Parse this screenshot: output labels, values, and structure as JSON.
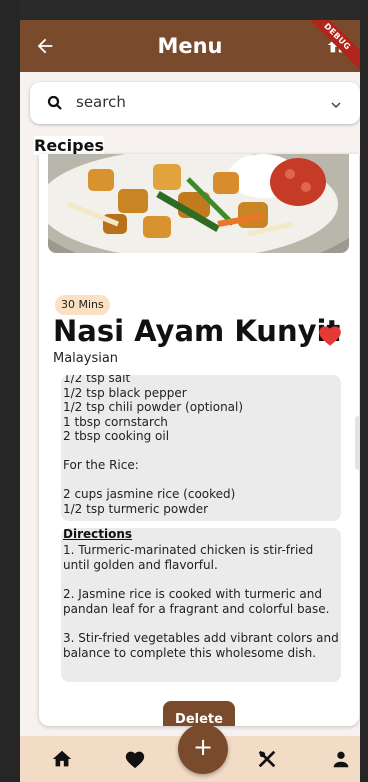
{
  "appbar": {
    "title": "Menu",
    "back_icon": "back-arrow-icon",
    "home_icon": "home-icon",
    "debug_banner": "DEBUG"
  },
  "search": {
    "placeholder": "search",
    "search_icon": "search-icon",
    "dropdown_icon": "chevron-down-icon"
  },
  "section_label": "Recipes",
  "recipe": {
    "time_badge": "30 Mins",
    "name": "Nasi Ayam Kunyit",
    "cuisine": "Malaysian",
    "favorite": true,
    "ingredients": [
      "1/2 tsp salt",
      "1/2 tsp black pepper",
      "1/2 tsp chili powder (optional)",
      "1 tbsp cornstarch",
      "2 tbsp cooking oil",
      "",
      "For the Rice:",
      "",
      "2 cups jasmine rice (cooked)",
      "1/2 tsp turmeric powder"
    ],
    "directions_heading": "Directions",
    "directions": [
      "1. Turmeric-marinated chicken is stir-fried until golden and flavorful.",
      "2. Jasmine rice is cooked with turmeric and pandan leaf for a fragrant and colorful base.",
      "3. Stir-fried vegetables add vibrant colors and balance to complete this wholesome dish."
    ],
    "delete_label": "Delete"
  },
  "bottom_nav": {
    "items": [
      "home-icon",
      "heart-icon",
      "add-icon",
      "utensils-icon",
      "person-icon"
    ],
    "fab_label": "+"
  },
  "colors": {
    "primary": "#7a4a2c",
    "nav_bg": "#f3dcc5",
    "heart": "#e53935",
    "badge_bg": "#fce0c4",
    "box_bg": "#ebebeb"
  }
}
